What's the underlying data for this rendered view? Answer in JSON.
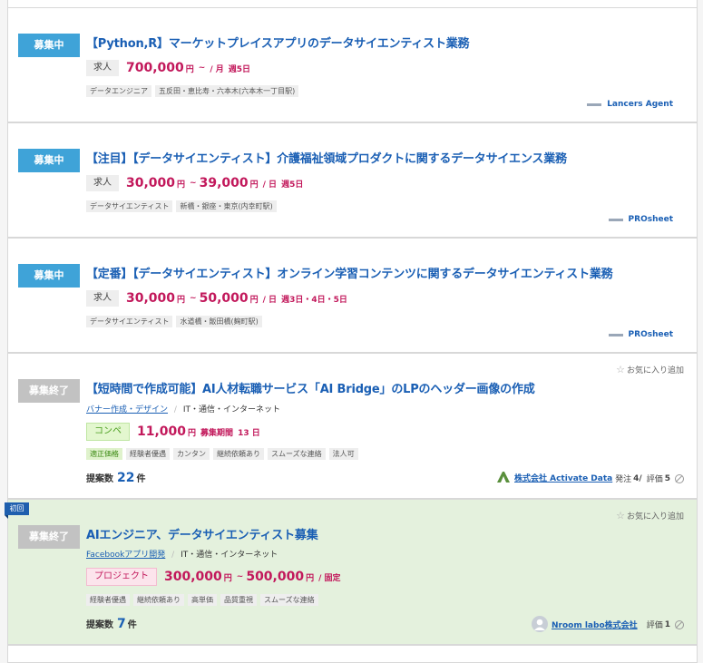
{
  "jobs": [
    {
      "status": "募集中",
      "title": "【Python,R】マーケットプレイスアプリのデータサイエンティスト業務",
      "price_type": "求人",
      "price_min": "700,000",
      "unit1": "円",
      "sep": "~",
      "per": "/ 月",
      "freq": "週5日",
      "tags": [
        "データエンジニア",
        "五反田・恵比寿・六本木(六本木一丁目駅)"
      ],
      "client": "Lancers Agent"
    },
    {
      "status": "募集中",
      "title": "【注目】【データサイエンティスト】介護福祉領域プロダクトに関するデータサイエンス業務",
      "price_type": "求人",
      "price_min": "30,000",
      "unit1": "円",
      "sep": "~",
      "price_max": "39,000",
      "unit2": "円",
      "per": "/ 日",
      "freq": "週5日",
      "tags": [
        "データサイエンティスト",
        "新橋・銀座・東京(内幸町駅)"
      ],
      "client": "PROsheet"
    },
    {
      "status": "募集中",
      "title": "【定番】【データサイエンティスト】オンライン学習コンテンツに関するデータサイエンティスト業務",
      "price_type": "求人",
      "price_min": "30,000",
      "unit1": "円",
      "sep": "~",
      "price_max": "50,000",
      "unit2": "円",
      "per": "/ 日",
      "freq": "週3日・4日・5日",
      "tags": [
        "データサイエンティスト",
        "水道橋・飯田橋(麹町駅)"
      ],
      "client": "PROsheet"
    },
    {
      "status": "募集終了",
      "title": "【短時間で作成可能】AI人材転職サービス「AI Bridge」のLPのヘッダー画像の作成",
      "category": "バナー作成・デザイン",
      "category_sep": "/",
      "industry": "IT・通信・インターネット",
      "favorite": "お気に入り追加",
      "price_type": "コンペ",
      "price_min": "11,000",
      "unit1": "円",
      "period_label": "募集期間",
      "period_value": "13 日",
      "tags": [
        "適正価格",
        "経験者優遇",
        "カンタン",
        "継続依頼あり",
        "スムーズな連絡",
        "法人可"
      ],
      "proposals_label": "提案数",
      "proposals": "22",
      "proposals_unit": "件",
      "company": "株式会社 Activate Data",
      "orders_label": "発注",
      "orders": "4/",
      "rating_label": "評価",
      "rating": "5"
    },
    {
      "badge": "初回",
      "status": "募集終了",
      "title": "AIエンジニア、データサイエンティスト募集",
      "category": "Facebookアプリ開発",
      "category_sep": "/",
      "industry": "IT・通信・インターネット",
      "favorite": "お気に入り追加",
      "price_type": "プロジェクト",
      "price_min": "300,000",
      "unit1": "円",
      "sep": "~",
      "price_max": "500,000",
      "unit2": "円",
      "per": "/ 固定",
      "tags": [
        "経験者優遇",
        "継続依頼あり",
        "高単価",
        "品質重視",
        "スムーズな連絡"
      ],
      "proposals_label": "提案数",
      "proposals": "7",
      "proposals_unit": "件",
      "company": "Nroom labo株式会社",
      "rating_label": "評価",
      "rating": "1"
    }
  ],
  "colors": {
    "open": "#3fa3d8",
    "closed": "#c2c2c2",
    "price": "#c2185b",
    "link": "#1a5fb4",
    "first_visit_bg": "#e4f1dd"
  }
}
